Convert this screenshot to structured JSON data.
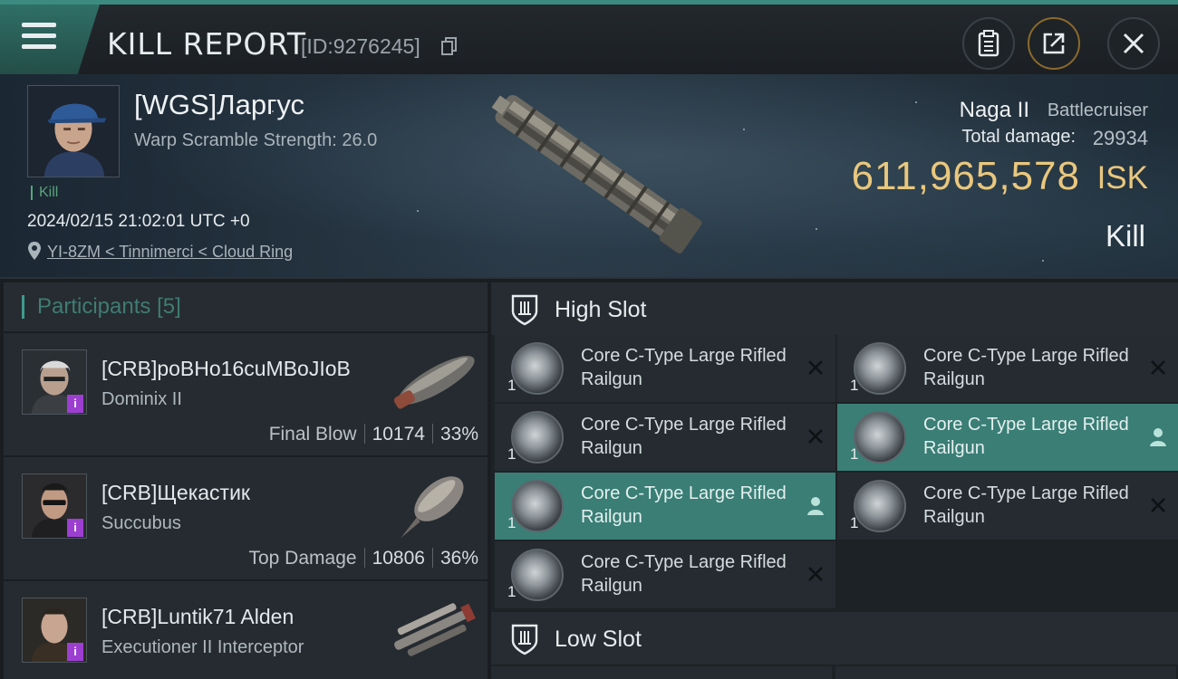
{
  "header": {
    "title": "KILL REPORT",
    "report_id": "[ID:9276245]"
  },
  "victim": {
    "name": "[WGS]Ларгус",
    "warp_scramble": "Warp Scramble Strength: 26.0",
    "tag": "Kill",
    "timestamp": "2024/02/15 21:02:01 UTC +0",
    "location": "YI-8ZM < Tinnimerci < Cloud Ring",
    "ship_name": "Naga II",
    "ship_class": "Battlecruiser",
    "total_damage_label": "Total damage:",
    "total_damage": "29934",
    "isk_value": "611,965,578",
    "isk_unit": "ISK",
    "result": "Kill"
  },
  "participants": {
    "title": "Participants",
    "count": "[5]",
    "rows": [
      {
        "name": "[CRB]poBHo16cuMBoJIoB",
        "ship": "Dominix II",
        "stat_label": "Final Blow",
        "damage": "10174",
        "percent": "33%"
      },
      {
        "name": "[CRB]Щекастик",
        "ship": "Succubus",
        "stat_label": "Top Damage",
        "damage": "10806",
        "percent": "36%"
      },
      {
        "name": "[CRB]Luntik71 Alden",
        "ship": "Executioner II Interceptor",
        "stat_label": "",
        "damage": "",
        "percent": ""
      }
    ]
  },
  "fitting": {
    "high_slot_label": "High Slot",
    "low_slot_label": "Low Slot",
    "high_modules": [
      {
        "name": "Core C-Type Large Rifled Railgun",
        "qty": "1",
        "status": "destroyed",
        "highlight": false
      },
      {
        "name": "Core C-Type Large Rifled Railgun",
        "qty": "1",
        "status": "destroyed",
        "highlight": false
      },
      {
        "name": "Core C-Type Large Rifled Railgun",
        "qty": "1",
        "status": "destroyed",
        "highlight": false
      },
      {
        "name": "Core C-Type Large Rifled Railgun",
        "qty": "1",
        "status": "dropped",
        "highlight": true
      },
      {
        "name": "Core C-Type Large Rifled Railgun",
        "qty": "1",
        "status": "dropped",
        "highlight": true
      },
      {
        "name": "Core C-Type Large Rifled Railgun",
        "qty": "1",
        "status": "destroyed",
        "highlight": false
      },
      {
        "name": "Core C-Type Large Rifled Railgun",
        "qty": "1",
        "status": "destroyed",
        "highlight": false
      }
    ]
  },
  "icons": {
    "menu": "hamburger-icon",
    "copy": "copy-icon",
    "clipboard": "clipboard-icon",
    "share": "share-icon",
    "close": "close-icon",
    "location": "location-pin-icon",
    "slot": "slot-shield-icon",
    "destroyed": "x-icon",
    "dropped": "person-icon"
  },
  "colors": {
    "accent": "#3f9a8c",
    "isk": "#e9c77d",
    "highlight_row": "#3a7e76",
    "corp_badge": "#9c3fd1"
  }
}
